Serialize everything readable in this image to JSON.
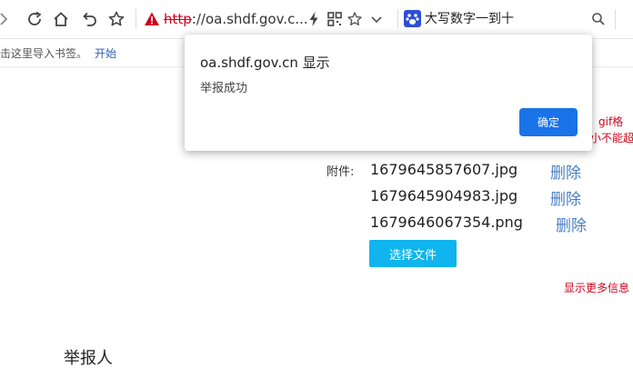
{
  "browser": {
    "url_scheme": "http",
    "url_rest": "://oa.shdf.gov.c...",
    "search_engine_text": "大写数字一到十"
  },
  "bookmarks": {
    "hint": "点击这里导入书签。",
    "start_link": "开始"
  },
  "dialog": {
    "title": "oa.shdf.gov.cn 显示",
    "message": "举报成功",
    "ok_label": "确定"
  },
  "page": {
    "red_note_1": "、gif格",
    "red_note_2": "小不能超",
    "attachment_label": "附件:",
    "attachments": [
      {
        "file": "1679645857607.jpg",
        "delete": "删除"
      },
      {
        "file": "1679645904983.jpg",
        "delete": "删除"
      },
      {
        "file": "1679646067354.png",
        "delete": "删除"
      }
    ],
    "choose_file_label": "选择文件",
    "more_info": "显示更多信息",
    "reporter_heading": "举报人"
  },
  "colors": {
    "accent_blue": "#1a73e8",
    "cyan_button": "#10b4ee",
    "alert_red": "#d0021b",
    "link_blue": "#4a7fc1"
  }
}
